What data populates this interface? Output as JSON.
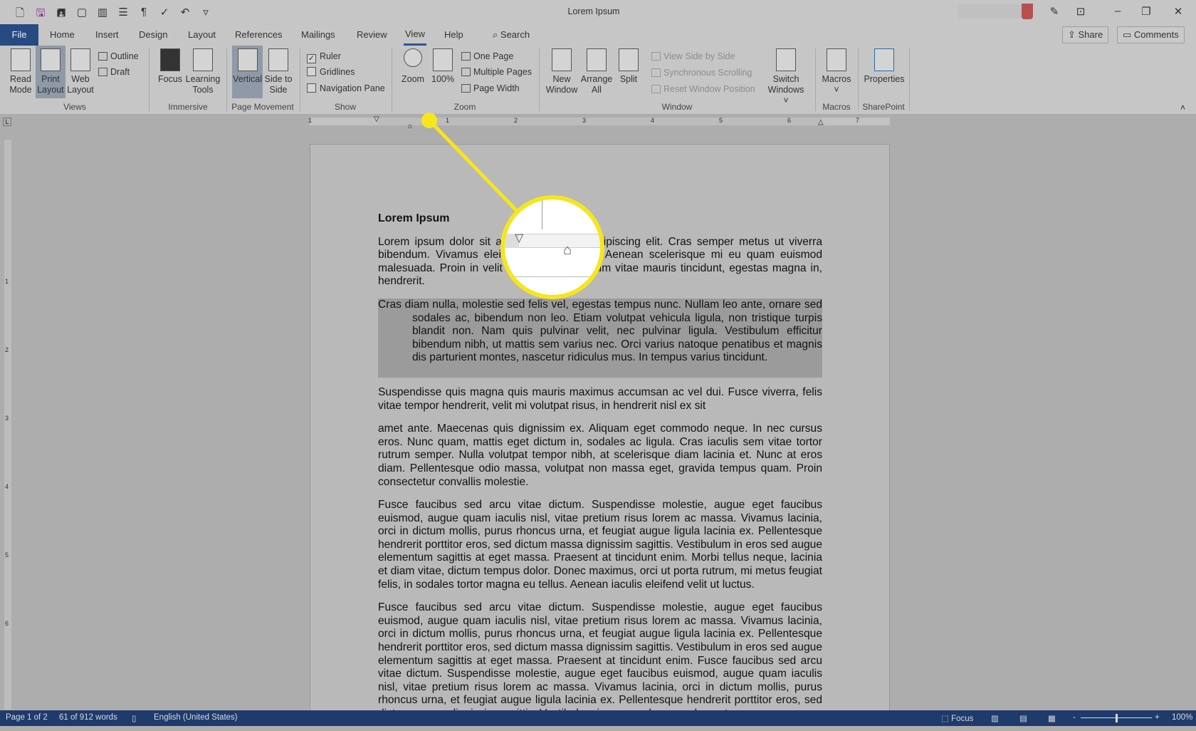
{
  "window": {
    "title": "Lorem Ipsum"
  },
  "quick_access": [
    "new-document-icon",
    "save-icon",
    "save-as-icon",
    "open-icon",
    "book-icon",
    "layout-icon",
    "pilcrow-icon",
    "spelling-icon",
    "undo-icon",
    "customize-icon"
  ],
  "tabs": [
    "File",
    "Home",
    "Insert",
    "Design",
    "Layout",
    "References",
    "Mailings",
    "Review",
    "View",
    "Help"
  ],
  "search": "Search",
  "share": "Share",
  "comments": "Comments",
  "ribbon": {
    "views": {
      "read_mode": "Read Mode",
      "print_layout": "Print Layout",
      "web_layout": "Web Layout",
      "outline": "Outline",
      "draft": "Draft",
      "label": "Views"
    },
    "immersive": {
      "focus": "Focus",
      "learning_tools": "Learning Tools",
      "label": "Immersive"
    },
    "page_movement": {
      "vertical": "Vertical",
      "side_to_side": "Side to Side",
      "label": "Page Movement"
    },
    "show": {
      "ruler": "Ruler",
      "ruler_checked": true,
      "gridlines": "Gridlines",
      "gridlines_checked": false,
      "navigation_pane": "Navigation Pane",
      "navigation_pane_checked": false,
      "label": "Show"
    },
    "zoom": {
      "zoom": "Zoom",
      "hundred": "100%",
      "one_page": "One Page",
      "multiple_pages": "Multiple Pages",
      "page_width": "Page Width",
      "label": "Zoom"
    },
    "window": {
      "new_window": "New Window",
      "arrange_all": "Arrange All",
      "split": "Split",
      "view_side_by_side": "View Side by Side",
      "synchronous_scrolling": "Synchronous Scrolling",
      "reset_window_position": "Reset Window Position",
      "switch_windows": "Switch Windows",
      "label": "Window"
    },
    "macros": {
      "macros": "Macros",
      "label": "Macros"
    },
    "sharepoint": {
      "properties": "Properties",
      "label": "SharePoint"
    }
  },
  "ruler_numbers": [
    "1",
    "1",
    "2",
    "3",
    "4",
    "5",
    "6",
    "7"
  ],
  "vruler_numbers": [
    "1",
    "2",
    "3",
    "4",
    "5",
    "6"
  ],
  "document": {
    "heading": "Lorem Ipsum",
    "paragraphs": [
      "Lorem ipsum dolor sit amet, consectetur adipiscing elit. Cras semper metus ut viverra bibendum. Vivamus eleifend ligula gravida. Aenean scelerisque mi eu quam euismod malesuada. Proin in velit convallis. Vestibulum vitae mauris tincidunt, egestas magna in, hendrerit.",
      "Cras diam nulla, molestie sed felis vel, egestas tempus nunc. Nullam leo ante, ornare sed sodales ac, bibendum non leo. Etiam volutpat vehicula ligula, non tristique turpis blandit non. Nam quis pulvinar velit, nec pulvinar ligula. Vestibulum efficitur bibendum nibh, ut mattis sem varius nec. Orci varius natoque penatibus et magnis dis parturient montes, nascetur ridiculus mus. In tempus varius tincidunt.",
      "Suspendisse quis magna quis mauris maximus accumsan ac vel dui. Fusce viverra, felis vitae tempor hendrerit, velit mi volutpat risus, in hendrerit nisl ex sit",
      "amet ante. Maecenas quis dignissim ex. Aliquam eget commodo neque. In nec cursus eros. Nunc quam, mattis eget dictum in, sodales ac ligula. Cras iaculis sem vitae tortor rutrum semper. Nulla volutpat tempor nibh, at scelerisque diam lacinia et. Nunc at eros diam. Pellentesque odio massa, volutpat non massa eget, gravida tempus quam. Proin consectetur convallis molestie.",
      "Fusce faucibus sed arcu vitae dictum. Suspendisse molestie, augue eget faucibus euismod, augue quam iaculis nisl, vitae pretium risus lorem ac massa. Vivamus lacinia, orci in dictum mollis, purus rhoncus urna, et feugiat augue ligula lacinia ex. Pellentesque hendrerit porttitor eros, sed dictum massa dignissim sagittis. Vestibulum in eros sed augue elementum sagittis at eget massa. Praesent at tincidunt enim. Morbi tellus neque, lacinia et diam vitae, dictum tempus dolor. Donec maximus, orci ut porta rutrum, mi metus feugiat felis, in sodales tortor magna eu tellus. Aenean iaculis eleifend velit ut luctus.",
      "Fusce faucibus sed arcu vitae dictum. Suspendisse molestie, augue eget faucibus euismod, augue quam iaculis nisl, vitae pretium risus lorem ac massa. Vivamus lacinia, orci in dictum mollis, purus rhoncus urna, et feugiat augue ligula lacinia ex. Pellentesque hendrerit porttitor eros, sed dictum massa dignissim sagittis. Vestibulum in eros sed augue elementum sagittis at eget massa. Praesent at tincidunt enim. Fusce faucibus sed arcu vitae dictum. Suspendisse molestie, augue eget faucibus euismod, augue quam iaculis nisl, vitae pretium risus lorem ac massa. Vivamus lacinia, orci in dictum mollis, purus rhoncus urna, et feugiat augue ligula lacinia ex. Pellentesque hendrerit porttitor eros, sed dictum massa dignissim sagittis. Vestibulum in eros sed augue elementum"
    ]
  },
  "status": {
    "page": "Page 1 of 2",
    "words": "61 of 912 words",
    "language": "English (United States)",
    "focus": "Focus",
    "zoom": "100%",
    "zoom_percent": 100
  },
  "colors": {
    "file_tab": "#284a82",
    "status_bar": "#1f3b6c",
    "highlight": "#f5e61e",
    "accent": "#2b579a"
  }
}
